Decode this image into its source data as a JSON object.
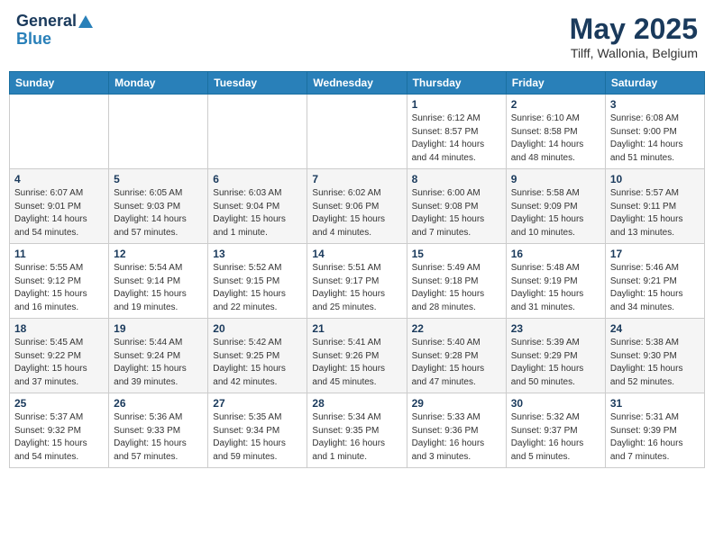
{
  "logo": {
    "line1": "General",
    "line2": "Blue"
  },
  "title": "May 2025",
  "subtitle": "Tilff, Wallonia, Belgium",
  "days_of_week": [
    "Sunday",
    "Monday",
    "Tuesday",
    "Wednesday",
    "Thursday",
    "Friday",
    "Saturday"
  ],
  "weeks": [
    [
      {
        "day": "",
        "info": ""
      },
      {
        "day": "",
        "info": ""
      },
      {
        "day": "",
        "info": ""
      },
      {
        "day": "",
        "info": ""
      },
      {
        "day": "1",
        "info": "Sunrise: 6:12 AM\nSunset: 8:57 PM\nDaylight: 14 hours\nand 44 minutes."
      },
      {
        "day": "2",
        "info": "Sunrise: 6:10 AM\nSunset: 8:58 PM\nDaylight: 14 hours\nand 48 minutes."
      },
      {
        "day": "3",
        "info": "Sunrise: 6:08 AM\nSunset: 9:00 PM\nDaylight: 14 hours\nand 51 minutes."
      }
    ],
    [
      {
        "day": "4",
        "info": "Sunrise: 6:07 AM\nSunset: 9:01 PM\nDaylight: 14 hours\nand 54 minutes."
      },
      {
        "day": "5",
        "info": "Sunrise: 6:05 AM\nSunset: 9:03 PM\nDaylight: 14 hours\nand 57 minutes."
      },
      {
        "day": "6",
        "info": "Sunrise: 6:03 AM\nSunset: 9:04 PM\nDaylight: 15 hours\nand 1 minute."
      },
      {
        "day": "7",
        "info": "Sunrise: 6:02 AM\nSunset: 9:06 PM\nDaylight: 15 hours\nand 4 minutes."
      },
      {
        "day": "8",
        "info": "Sunrise: 6:00 AM\nSunset: 9:08 PM\nDaylight: 15 hours\nand 7 minutes."
      },
      {
        "day": "9",
        "info": "Sunrise: 5:58 AM\nSunset: 9:09 PM\nDaylight: 15 hours\nand 10 minutes."
      },
      {
        "day": "10",
        "info": "Sunrise: 5:57 AM\nSunset: 9:11 PM\nDaylight: 15 hours\nand 13 minutes."
      }
    ],
    [
      {
        "day": "11",
        "info": "Sunrise: 5:55 AM\nSunset: 9:12 PM\nDaylight: 15 hours\nand 16 minutes."
      },
      {
        "day": "12",
        "info": "Sunrise: 5:54 AM\nSunset: 9:14 PM\nDaylight: 15 hours\nand 19 minutes."
      },
      {
        "day": "13",
        "info": "Sunrise: 5:52 AM\nSunset: 9:15 PM\nDaylight: 15 hours\nand 22 minutes."
      },
      {
        "day": "14",
        "info": "Sunrise: 5:51 AM\nSunset: 9:17 PM\nDaylight: 15 hours\nand 25 minutes."
      },
      {
        "day": "15",
        "info": "Sunrise: 5:49 AM\nSunset: 9:18 PM\nDaylight: 15 hours\nand 28 minutes."
      },
      {
        "day": "16",
        "info": "Sunrise: 5:48 AM\nSunset: 9:19 PM\nDaylight: 15 hours\nand 31 minutes."
      },
      {
        "day": "17",
        "info": "Sunrise: 5:46 AM\nSunset: 9:21 PM\nDaylight: 15 hours\nand 34 minutes."
      }
    ],
    [
      {
        "day": "18",
        "info": "Sunrise: 5:45 AM\nSunset: 9:22 PM\nDaylight: 15 hours\nand 37 minutes."
      },
      {
        "day": "19",
        "info": "Sunrise: 5:44 AM\nSunset: 9:24 PM\nDaylight: 15 hours\nand 39 minutes."
      },
      {
        "day": "20",
        "info": "Sunrise: 5:42 AM\nSunset: 9:25 PM\nDaylight: 15 hours\nand 42 minutes."
      },
      {
        "day": "21",
        "info": "Sunrise: 5:41 AM\nSunset: 9:26 PM\nDaylight: 15 hours\nand 45 minutes."
      },
      {
        "day": "22",
        "info": "Sunrise: 5:40 AM\nSunset: 9:28 PM\nDaylight: 15 hours\nand 47 minutes."
      },
      {
        "day": "23",
        "info": "Sunrise: 5:39 AM\nSunset: 9:29 PM\nDaylight: 15 hours\nand 50 minutes."
      },
      {
        "day": "24",
        "info": "Sunrise: 5:38 AM\nSunset: 9:30 PM\nDaylight: 15 hours\nand 52 minutes."
      }
    ],
    [
      {
        "day": "25",
        "info": "Sunrise: 5:37 AM\nSunset: 9:32 PM\nDaylight: 15 hours\nand 54 minutes."
      },
      {
        "day": "26",
        "info": "Sunrise: 5:36 AM\nSunset: 9:33 PM\nDaylight: 15 hours\nand 57 minutes."
      },
      {
        "day": "27",
        "info": "Sunrise: 5:35 AM\nSunset: 9:34 PM\nDaylight: 15 hours\nand 59 minutes."
      },
      {
        "day": "28",
        "info": "Sunrise: 5:34 AM\nSunset: 9:35 PM\nDaylight: 16 hours\nand 1 minute."
      },
      {
        "day": "29",
        "info": "Sunrise: 5:33 AM\nSunset: 9:36 PM\nDaylight: 16 hours\nand 3 minutes."
      },
      {
        "day": "30",
        "info": "Sunrise: 5:32 AM\nSunset: 9:37 PM\nDaylight: 16 hours\nand 5 minutes."
      },
      {
        "day": "31",
        "info": "Sunrise: 5:31 AM\nSunset: 9:39 PM\nDaylight: 16 hours\nand 7 minutes."
      }
    ]
  ]
}
